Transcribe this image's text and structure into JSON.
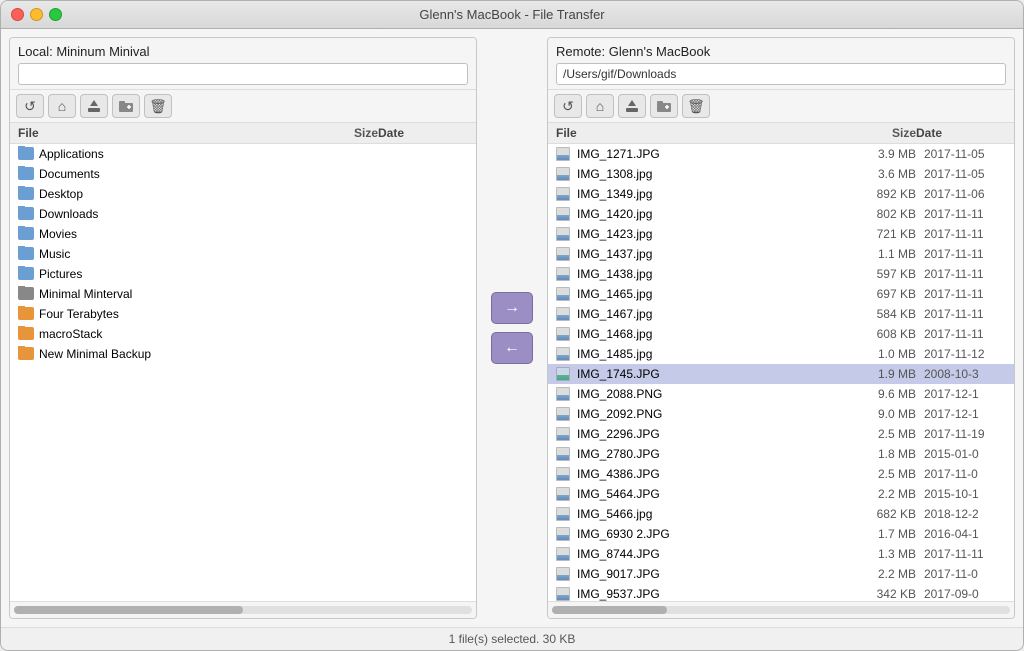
{
  "window": {
    "title": "Glenn's MacBook - File Transfer"
  },
  "left_pane": {
    "label": "Local:",
    "location": "Mininum Minival",
    "path_placeholder": "",
    "columns": [
      "File",
      "Size",
      "Date"
    ],
    "files": [
      {
        "name": "Applications",
        "icon": "folder-blue",
        "size": "",
        "date": ""
      },
      {
        "name": "Documents",
        "icon": "folder-blue",
        "size": "",
        "date": ""
      },
      {
        "name": "Desktop",
        "icon": "folder-blue",
        "size": "",
        "date": ""
      },
      {
        "name": "Downloads",
        "icon": "folder-blue",
        "size": "",
        "date": ""
      },
      {
        "name": "Movies",
        "icon": "folder-blue",
        "size": "",
        "date": ""
      },
      {
        "name": "Music",
        "icon": "folder-blue",
        "size": "",
        "date": ""
      },
      {
        "name": "Pictures",
        "icon": "folder-blue",
        "size": "",
        "date": ""
      },
      {
        "name": "Minimal Minterval",
        "icon": "folder-gray",
        "size": "",
        "date": ""
      },
      {
        "name": "Four Terabytes",
        "icon": "folder-orange",
        "size": "",
        "date": ""
      },
      {
        "name": "macroStack",
        "icon": "folder-orange",
        "size": "",
        "date": ""
      },
      {
        "name": "New Minimal Backup",
        "icon": "folder-orange",
        "size": "",
        "date": ""
      }
    ]
  },
  "right_pane": {
    "label": "Remote:",
    "location": "Glenn's MacBook",
    "path": "/Users/gif/Downloads",
    "columns": [
      "File",
      "Size",
      "Date"
    ],
    "files": [
      {
        "name": "IMG_1271.JPG",
        "icon": "img",
        "size": "3.9 MB",
        "date": "2017-11-05"
      },
      {
        "name": "IMG_1308.jpg",
        "icon": "img",
        "size": "3.6 MB",
        "date": "2017-11-05"
      },
      {
        "name": "IMG_1349.jpg",
        "icon": "img",
        "size": "892 KB",
        "date": "2017-11-06"
      },
      {
        "name": "IMG_1420.jpg",
        "icon": "img",
        "size": "802 KB",
        "date": "2017-11-11"
      },
      {
        "name": "IMG_1423.jpg",
        "icon": "img",
        "size": "721 KB",
        "date": "2017-11-11"
      },
      {
        "name": "IMG_1437.jpg",
        "icon": "img",
        "size": "1.1 MB",
        "date": "2017-11-11"
      },
      {
        "name": "IMG_1438.jpg",
        "icon": "img",
        "size": "597 KB",
        "date": "2017-11-11"
      },
      {
        "name": "IMG_1465.jpg",
        "icon": "img",
        "size": "697 KB",
        "date": "2017-11-11"
      },
      {
        "name": "IMG_1467.jpg",
        "icon": "img",
        "size": "584 KB",
        "date": "2017-11-11"
      },
      {
        "name": "IMG_1468.jpg",
        "icon": "img",
        "size": "608 KB",
        "date": "2017-11-11"
      },
      {
        "name": "IMG_1485.jpg",
        "icon": "img",
        "size": "1.0 MB",
        "date": "2017-11-12"
      },
      {
        "name": "IMG_1745.JPG",
        "icon": "img-photo",
        "size": "1.9 MB",
        "date": "2008-10-3"
      },
      {
        "name": "IMG_2088.PNG",
        "icon": "img",
        "size": "9.6 MB",
        "date": "2017-12-1"
      },
      {
        "name": "IMG_2092.PNG",
        "icon": "img",
        "size": "9.0 MB",
        "date": "2017-12-1"
      },
      {
        "name": "IMG_2296.JPG",
        "icon": "img",
        "size": "2.5 MB",
        "date": "2017-11-19"
      },
      {
        "name": "IMG_2780.JPG",
        "icon": "img",
        "size": "1.8 MB",
        "date": "2015-01-0"
      },
      {
        "name": "IMG_4386.JPG",
        "icon": "img",
        "size": "2.5 MB",
        "date": "2017-11-0"
      },
      {
        "name": "IMG_5464.JPG",
        "icon": "img",
        "size": "2.2 MB",
        "date": "2015-10-1"
      },
      {
        "name": "IMG_5466.jpg",
        "icon": "img",
        "size": "682 KB",
        "date": "2018-12-2"
      },
      {
        "name": "IMG_6930 2.JPG",
        "icon": "img",
        "size": "1.7 MB",
        "date": "2016-04-1"
      },
      {
        "name": "IMG_8744.JPG",
        "icon": "img",
        "size": "1.3 MB",
        "date": "2017-11-11"
      },
      {
        "name": "IMG_9017.JPG",
        "icon": "img",
        "size": "2.2 MB",
        "date": "2017-11-0"
      },
      {
        "name": "IMG_9537.JPG",
        "icon": "img",
        "size": "342 KB",
        "date": "2017-09-0"
      }
    ]
  },
  "toolbar": {
    "refresh_label": "↺",
    "home_label": "⌂",
    "upload_label": "⬆",
    "new_folder_label": "+",
    "delete_label": "✕"
  },
  "transfer": {
    "right_arrow": "→",
    "left_arrow": "←"
  },
  "status": {
    "text": "1 file(s) selected. 30 KB"
  }
}
